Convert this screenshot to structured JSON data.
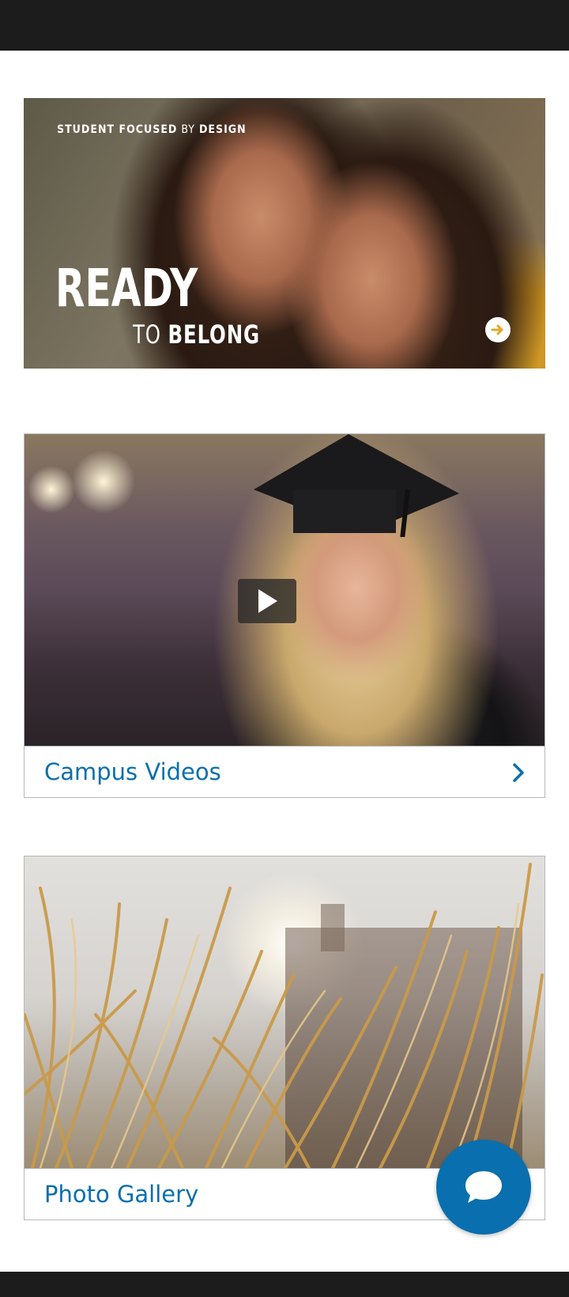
{
  "banner": {
    "tag_bold1": "STUDENT FOCUSED",
    "tag_light": " BY ",
    "tag_bold2": "DESIGN",
    "headline": "READY",
    "sub_light": "TO ",
    "sub_bold": "BELONG"
  },
  "cards": [
    {
      "label": "Campus Videos"
    },
    {
      "label": "Photo Gallery"
    }
  ],
  "colors": {
    "accent": "#0a6fae",
    "topbar": "#1c1c1c"
  },
  "icons": {
    "banner_arrow": "arrow-right-circle-icon",
    "video_play": "play-icon",
    "card_chevron": "chevron-right-icon",
    "chat": "chat-bubble-icon"
  }
}
